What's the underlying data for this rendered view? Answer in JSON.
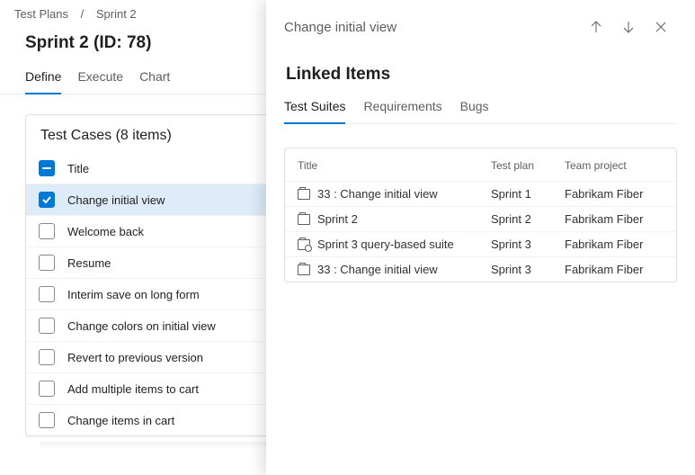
{
  "breadcrumb": {
    "root": "Test Plans",
    "current": "Sprint 2"
  },
  "title": "Sprint 2 (ID: 78)",
  "tabs": {
    "define": "Define",
    "execute": "Execute",
    "chart": "Chart"
  },
  "list": {
    "heading": "Test Cases (8 items)",
    "header_col": "Title",
    "items": [
      "Change initial view",
      "Welcome back",
      "Resume",
      "Interim save on long form",
      "Change colors on initial view",
      "Revert to previous version",
      "Add multiple items to cart",
      "Change items in cart"
    ]
  },
  "panel": {
    "header": "Change initial view",
    "section": "Linked Items",
    "tabs": {
      "suites": "Test Suites",
      "reqs": "Requirements",
      "bugs": "Bugs"
    },
    "cols": {
      "title": "Title",
      "plan": "Test plan",
      "team": "Team project"
    },
    "rows": [
      {
        "title": "33 : Change initial view",
        "plan": "Sprint 1",
        "team": "Fabrikam Fiber",
        "icon": "static"
      },
      {
        "title": "Sprint 2",
        "plan": "Sprint 2",
        "team": "Fabrikam Fiber",
        "icon": "static"
      },
      {
        "title": "Sprint 3 query-based suite",
        "plan": "Sprint 3",
        "team": "Fabrikam Fiber",
        "icon": "query"
      },
      {
        "title": "33 : Change initial view",
        "plan": "Sprint 3",
        "team": "Fabrikam Fiber",
        "icon": "static"
      }
    ]
  }
}
